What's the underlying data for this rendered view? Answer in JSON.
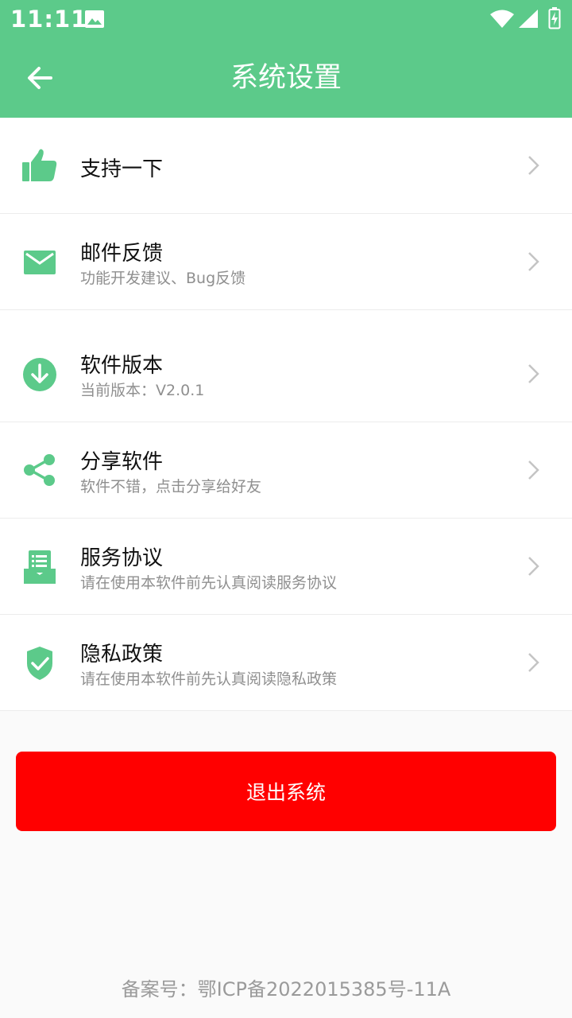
{
  "status_bar": {
    "time": "11:11",
    "icons": [
      "image-icon",
      "wifi-icon",
      "signal-icon",
      "battery-charging-icon"
    ]
  },
  "header": {
    "title": "系统设置",
    "back_icon": "arrow-left-icon",
    "background": "#5cca8a"
  },
  "settings": {
    "items": [
      {
        "label": "支持一下",
        "subtitle": "",
        "icon": "thumbs-up-icon"
      },
      {
        "label": "邮件反馈",
        "subtitle": "功能开发建议、Bug反馈",
        "icon": "mail-icon"
      },
      {
        "label": "软件版本",
        "subtitle": "当前版本：V2.0.1",
        "icon": "download-icon"
      },
      {
        "label": "分享软件",
        "subtitle": "软件不错，点击分享给好友",
        "icon": "share-icon"
      },
      {
        "label": "服务协议",
        "subtitle": "请在使用本软件前先认真阅读服务协议",
        "icon": "document-tray-icon"
      },
      {
        "label": "隐私政策",
        "subtitle": "请在使用本软件前先认真阅读隐私政策",
        "icon": "shield-check-icon"
      }
    ]
  },
  "logout": {
    "label": "退出系统",
    "color": "#ff0000"
  },
  "footer": {
    "icp": "备案号：鄂ICP备2022015385号-11A"
  },
  "colors": {
    "accent": "#5cca8a",
    "chevron": "#c4c4c4"
  }
}
